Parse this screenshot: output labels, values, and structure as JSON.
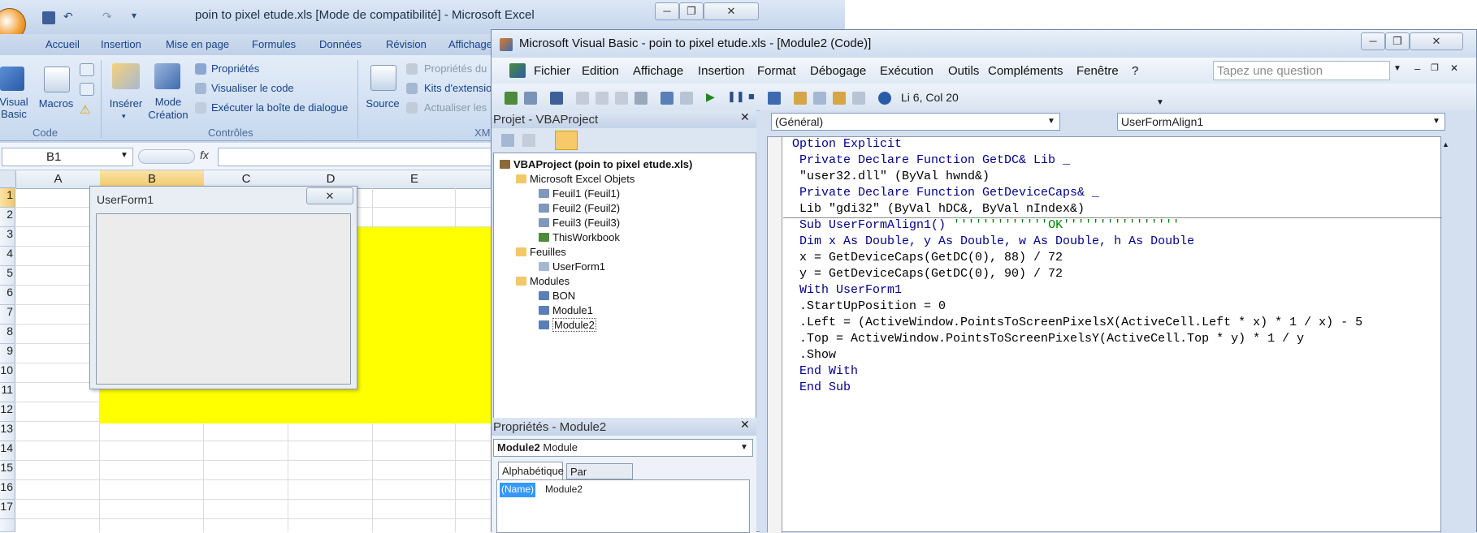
{
  "excel": {
    "title": "poin to pixel etude.xls  [Mode de compatibilité] - Microsoft Excel",
    "window_buttons": [
      "─",
      "❐",
      "✕"
    ],
    "tabs": [
      "Accueil",
      "Insertion",
      "Mise en page",
      "Formules",
      "Données",
      "Révision",
      "Affichage"
    ],
    "ribbon": {
      "code_group": {
        "label": "Code",
        "visual_basic": "Visual\nBasic",
        "macros": "Macros"
      },
      "controls_group": {
        "label": "Contrôles",
        "insert": "Insérer",
        "design_mode": "Mode\nCréation",
        "properties": "Propriétés",
        "view_code": "Visualiser le code",
        "run_dialog": "Exécuter la boîte de dialogue"
      },
      "xml_group": {
        "label": "XM",
        "source": "Source",
        "map_properties": "Propriétés du",
        "expansion_packs": "Kits d'extensio",
        "refresh": "Actualiser les"
      }
    },
    "name_box": "B1",
    "fx": "fx",
    "columns": [
      "A",
      "B",
      "C",
      "D",
      "E"
    ],
    "rows": [
      "1",
      "2",
      "3",
      "4",
      "5",
      "6",
      "7",
      "8",
      "9",
      "10",
      "11",
      "12",
      "13",
      "14",
      "15",
      "16",
      "17"
    ]
  },
  "userform": {
    "title": "UserForm1",
    "close": "✕"
  },
  "vbe": {
    "title": "Microsoft Visual Basic - poin to pixel etude.xls - [Module2 (Code)]",
    "window_buttons": [
      "─",
      "❐",
      "✕"
    ],
    "menu": [
      "Fichier",
      "Edition",
      "Affichage",
      "Insertion",
      "Format",
      "Débogage",
      "Exécution",
      "Outils",
      "Compléments",
      "Fenêtre",
      "?"
    ],
    "question_placeholder": "Tapez une question",
    "mdi_buttons": [
      "–",
      "❐",
      "✕"
    ],
    "cursor_position": "Li 6, Col 20",
    "project_pane": {
      "title": "Projet - VBAProject",
      "close": "✕",
      "tree": {
        "root": "VBAProject (poin to pixel etude.xls)",
        "excel_objects": "Microsoft Excel Objets",
        "sheets": [
          "Feuil1 (Feuil1)",
          "Feuil2 (Feuil2)",
          "Feuil3 (Feuil3)",
          "ThisWorkbook"
        ],
        "forms_folder": "Feuilles",
        "forms": [
          "UserForm1"
        ],
        "modules_folder": "Modules",
        "modules": [
          "BON",
          "Module1",
          "Module2"
        ]
      }
    },
    "properties_pane": {
      "title": "Propriétés - Module2",
      "close": "✕",
      "object_name": "Module2",
      "object_type": "Module",
      "tabs": [
        "Alphabétique",
        "Par catégorie"
      ],
      "name_key": "(Name)",
      "name_value": "Module2"
    },
    "code_window": {
      "object_combo": "(Général)",
      "proc_combo": "UserFormAlign1",
      "declarations": [
        "Option Explicit",
        " Private Declare Function GetDC& Lib _",
        " \"user32.dll\" (ByVal hwnd&)",
        " Private Declare Function GetDeviceCaps& _",
        " Lib \"gdi32\" (ByVal hDC&, ByVal nIndex&)"
      ],
      "sub_header": " Sub UserFormAlign1() ",
      "sub_comment": "'''''''''''''OK''''''''''''''''",
      "body": [
        " Dim x As Double, y As Double, w As Double, h As Double",
        " x = GetDeviceCaps(GetDC(0), 88) / 72",
        " y = GetDeviceCaps(GetDC(0), 90) / 72",
        " With UserForm1",
        " .StartUpPosition = 0",
        " .Left = (ActiveWindow.PointsToScreenPixelsX(ActiveCell.Left * x) * 1 / x) - 5",
        " .Top = ActiveWindow.PointsToScreenPixelsY(ActiveCell.Top * y) * 1 / y",
        " .Show",
        " End With",
        " End Sub"
      ]
    }
  }
}
